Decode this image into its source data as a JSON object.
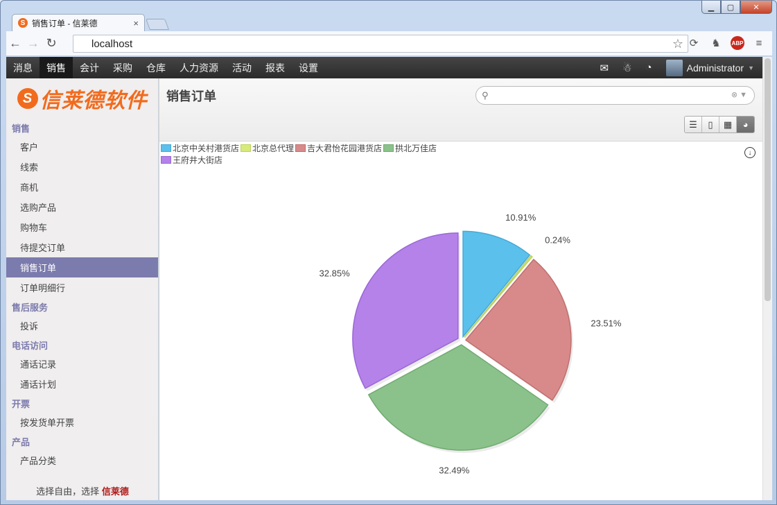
{
  "browser": {
    "tab_title": "销售订单 - 信莱德",
    "tab_favicon": "S",
    "address": "localhost",
    "window_controls": [
      "min",
      "max",
      "close"
    ]
  },
  "topnav": {
    "items": [
      "消息",
      "销售",
      "会计",
      "采购",
      "仓库",
      "人力资源",
      "活动",
      "报表",
      "设置"
    ],
    "active_index": 1,
    "user": "Administrator"
  },
  "sidebar": {
    "logo_text": "信莱德软件",
    "logo_mark": "S",
    "sections": [
      {
        "title": "销售",
        "items": [
          "客户",
          "线索",
          "商机",
          "选购产品",
          "购物车",
          "待提交订单",
          "销售订单",
          "订单明细行"
        ]
      },
      {
        "title": "售后服务",
        "items": [
          "投诉"
        ]
      },
      {
        "title": "电话访问",
        "items": [
          "通话记录",
          "通话计划"
        ]
      },
      {
        "title": "开票",
        "items": [
          "按发货单开票"
        ]
      },
      {
        "title": "产品",
        "items": [
          "产品分类"
        ]
      }
    ],
    "active_item": "销售订单",
    "footer_text": "选择自由，选择",
    "footer_brand": "信莱德"
  },
  "main": {
    "title": "销售订单",
    "search_placeholder": "",
    "views": [
      "list",
      "form",
      "calendar",
      "graph"
    ],
    "active_view": "graph"
  },
  "chart_data": {
    "type": "pie",
    "categories": [
      "北京中关村港货店",
      "北京总代理",
      "吉大君怡花园港货店",
      "拱北万佳店",
      "王府井大街店"
    ],
    "values": [
      10.91,
      0.24,
      23.51,
      32.49,
      32.85
    ],
    "labels": [
      "10.91%",
      "0.24%",
      "23.51%",
      "32.49%",
      "32.85%"
    ],
    "colors": [
      "#5bc0ec",
      "#d7ea7a",
      "#d88a8a",
      "#8bc28b",
      "#b482e8"
    ],
    "edge_colors": [
      "#45a9d6",
      "#bcd25c",
      "#c06e6e",
      "#70aa70",
      "#9b66d8"
    ],
    "legend_position": "top-left",
    "start": "top",
    "direction": "clockwise",
    "exploded": true
  }
}
